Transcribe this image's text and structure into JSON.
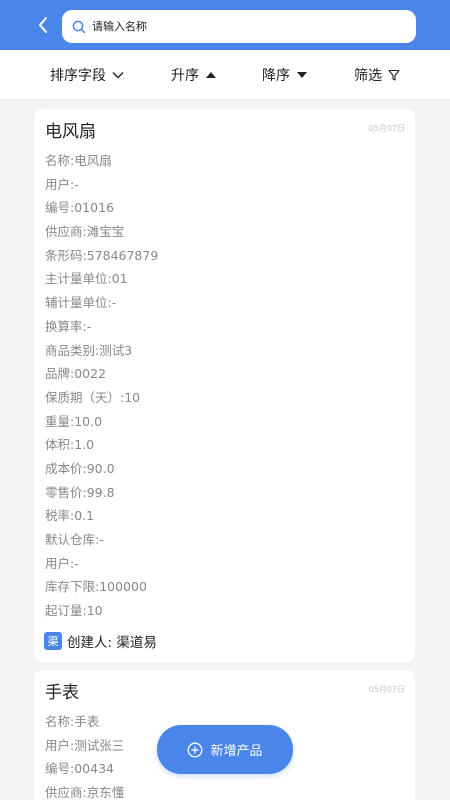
{
  "header": {
    "search_placeholder": "请输入名称"
  },
  "sortbar": {
    "field_label": "排序字段",
    "asc_label": "升序",
    "desc_label": "降序",
    "filter_label": "筛选"
  },
  "products": [
    {
      "title": "电风扇",
      "date": "05月07日",
      "fields": [
        "名称:电风扇",
        "用户:-",
        "编号:01016",
        "供应商:滩宝宝",
        "条形码:578467879",
        "主计量单位:01",
        "辅计量单位:-",
        "换算率:-",
        "商品类别:测试3",
        "品牌:0022",
        "保质期（天）:10",
        "重量:10.0",
        "体积:1.0",
        "成本价:90.0",
        "零售价:99.8",
        "税率:0.1",
        "默认仓库:-",
        "用户:-",
        "库存下限:100000",
        "起订量:10"
      ],
      "creator_badge": "渠",
      "creator": "创建人: 渠道易"
    },
    {
      "title": "手表",
      "date": "05月07日",
      "fields": [
        "名称:手表",
        "用户:测试张三",
        "编号:00434",
        "供应商:京东懂"
      ]
    }
  ],
  "fab": {
    "label": "新增产品"
  },
  "colors": {
    "accent": "#4a86ea",
    "background": "#f2f3f5"
  }
}
